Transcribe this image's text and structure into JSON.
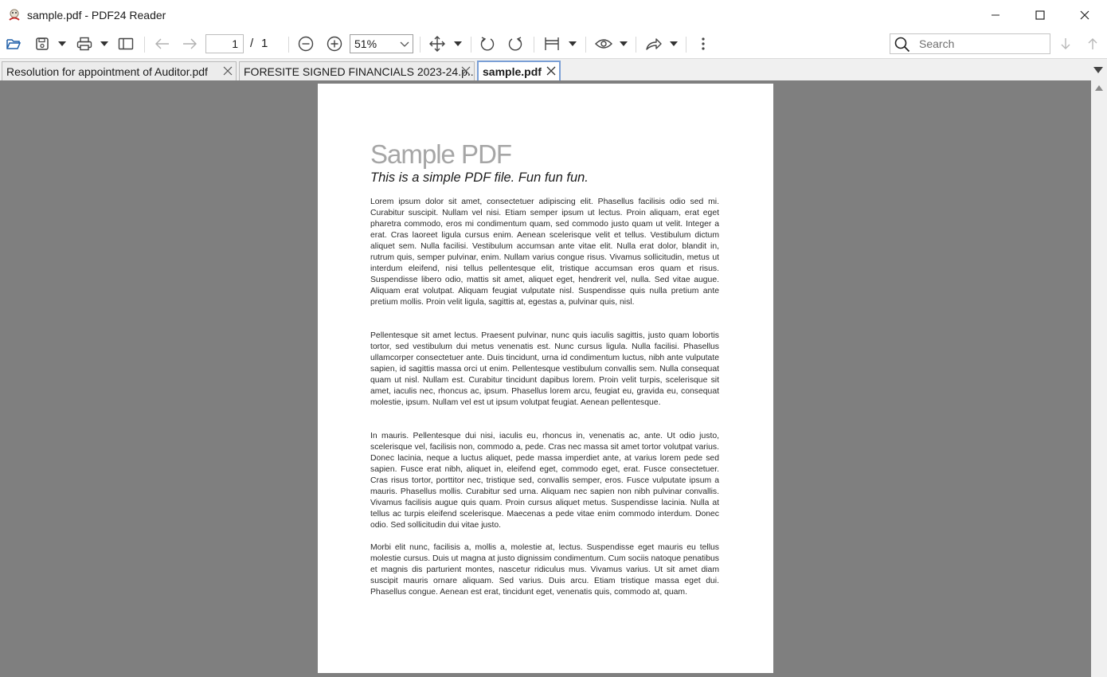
{
  "window": {
    "title": "sample.pdf - PDF24 Reader"
  },
  "toolbar": {
    "page_current": "1",
    "page_separator": "/",
    "page_total": "1",
    "zoom": "51%",
    "search_placeholder": "Search"
  },
  "tabs": [
    {
      "label": "Resolution for appointment of Auditor.pdf",
      "active": false
    },
    {
      "label": "FORESITE SIGNED FINANCIALS 2023-24.p...",
      "active": false
    },
    {
      "label": "sample.pdf",
      "active": true
    }
  ],
  "document": {
    "title": "Sample PDF",
    "subtitle": "This is a simple PDF file. Fun fun fun.",
    "paragraphs": [
      "Lorem ipsum dolor sit amet, consectetuer adipiscing elit. Phasellus facilisis odio sed mi. Curabitur suscipit. Nullam vel nisi. Etiam semper ipsum ut lectus. Proin aliquam, erat eget pharetra commodo, eros mi condimentum quam, sed commodo justo quam ut velit. Integer a erat. Cras laoreet ligula cursus enim. Aenean scelerisque velit et tellus. Vestibulum dictum aliquet sem. Nulla facilisi. Vestibulum accumsan ante vitae elit. Nulla erat dolor, blandit in, rutrum quis, semper pulvinar, enim. Nullam varius congue risus. Vivamus sollicitudin, metus ut interdum eleifend, nisi tellus pellentesque elit, tristique accumsan eros quam et risus. Suspendisse libero odio, mattis sit amet, aliquet eget, hendrerit vel, nulla. Sed vitae augue. Aliquam erat volutpat. Aliquam feugiat vulputate nisl. Suspendisse quis nulla pretium ante pretium mollis. Proin velit ligula, sagittis at, egestas a, pulvinar quis, nisl.",
      "Pellentesque sit amet lectus. Praesent pulvinar, nunc quis iaculis sagittis, justo quam lobortis tortor, sed vestibulum dui metus venenatis est. Nunc cursus ligula. Nulla facilisi. Phasellus ullamcorper consectetuer ante. Duis tincidunt, urna id condimentum luctus, nibh ante vulputate sapien, id sagittis massa orci ut enim. Pellentesque vestibulum convallis sem. Nulla consequat quam ut nisl. Nullam est. Curabitur tincidunt dapibus lorem. Proin velit turpis, scelerisque sit amet, iaculis nec, rhoncus ac, ipsum. Phasellus lorem arcu, feugiat eu, gravida eu, consequat molestie, ipsum. Nullam vel est ut ipsum volutpat feugiat. Aenean pellentesque.",
      "In mauris. Pellentesque dui nisi, iaculis eu, rhoncus in, venenatis ac, ante. Ut odio justo, scelerisque vel, facilisis non, commodo a, pede. Cras nec massa sit amet tortor volutpat varius. Donec lacinia, neque a luctus aliquet, pede massa imperdiet ante, at varius lorem pede sed sapien. Fusce erat nibh, aliquet in, eleifend eget, commodo eget, erat. Fusce consectetuer. Cras risus tortor, porttitor nec, tristique sed, convallis semper, eros. Fusce vulputate ipsum a mauris. Phasellus mollis. Curabitur sed urna. Aliquam nec sapien non nibh pulvinar convallis. Vivamus facilisis augue quis quam. Proin cursus aliquet metus. Suspendisse lacinia. Nulla at tellus ac turpis eleifend scelerisque. Maecenas a pede vitae enim commodo interdum. Donec odio. Sed sollicitudin dui vitae justo.",
      "Morbi elit nunc, facilisis a, mollis a, molestie at, lectus. Suspendisse eget mauris eu tellus molestie cursus. Duis ut magna at justo dignissim condimentum. Cum sociis natoque penatibus et magnis dis parturient montes, nascetur ridiculus mus. Vivamus varius. Ut sit amet diam suscipit mauris ornare aliquam. Sed varius. Duis arcu. Etiam tristique massa eget dui. Phasellus congue. Aenean est erat, tincidunt eget, venenatis quis, commodo at, quam."
    ]
  },
  "colors": {
    "viewer_background": "#7f7f7f",
    "active_tab_border": "#7a9fd6",
    "doc_title": "#a6a6a6"
  }
}
